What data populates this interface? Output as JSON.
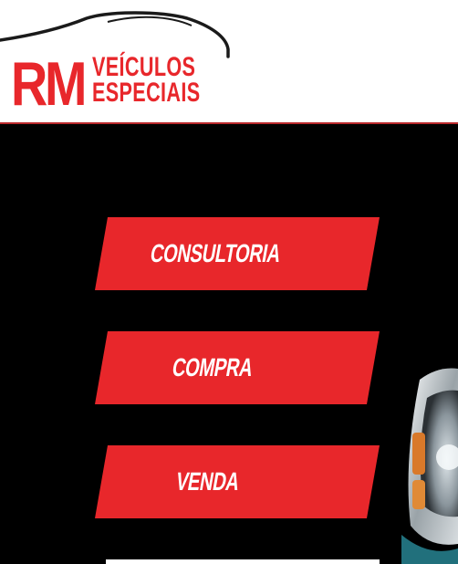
{
  "logo": {
    "rm": "RM",
    "line1": "VEÍCULOS",
    "line2": "ESPECIAIS",
    "icon": "car-outline-icon"
  },
  "menu": {
    "items": [
      {
        "label": "CONSULTORIA"
      },
      {
        "label": "COMPRA"
      },
      {
        "label": "VENDA"
      }
    ]
  },
  "colors": {
    "accent": "#e8272b",
    "background": "#000000",
    "header_background": "#ffffff",
    "button_text": "#ffffff"
  },
  "decor": {
    "image": "classic-car-headlight"
  }
}
